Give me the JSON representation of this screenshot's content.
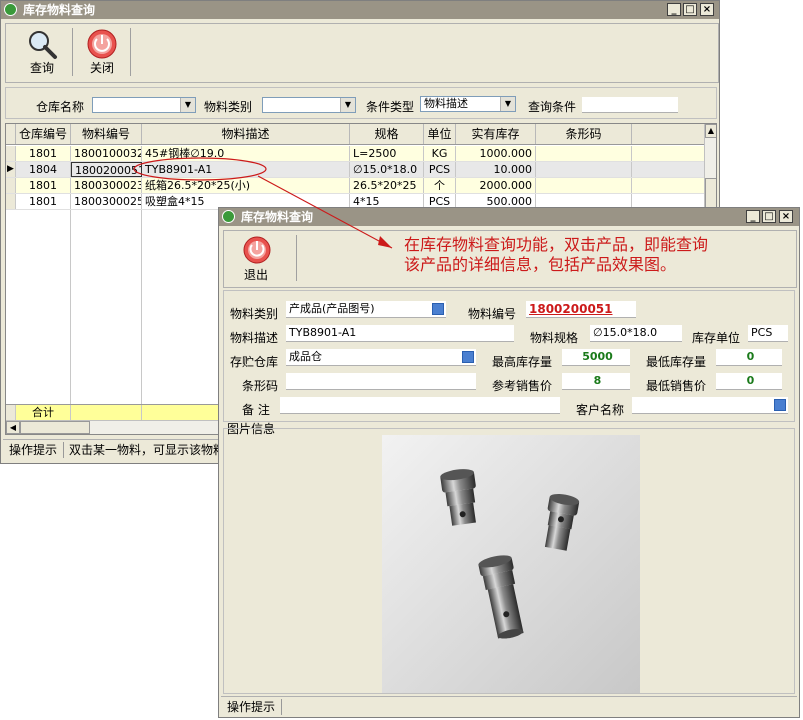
{
  "main_window": {
    "title": "库存物料查询",
    "toolbar": {
      "query_label": "查询",
      "close_label": "关闭"
    },
    "filters": {
      "warehouse_label": "仓库名称",
      "category_label": "物料类别",
      "condition_type_label": "条件类型",
      "condition_type_value": "物料描述",
      "query_condition_label": "查询条件"
    },
    "grid": {
      "columns": [
        "仓库编号",
        "物料编号",
        "物料描述",
        "规格",
        "单位",
        "实有库存",
        "条形码"
      ],
      "rows": [
        [
          "1801",
          "1800100032",
          "45#钢棒∅19.0",
          "L=2500",
          "KG",
          "1000.000",
          ""
        ],
        [
          "1804",
          "1800200051",
          "TYB8901-A1",
          "∅15.0*18.0",
          "PCS",
          "10.000",
          ""
        ],
        [
          "1801",
          "1800300023",
          "纸箱26.5*20*25(小)",
          "26.5*20*25",
          "个",
          "2000.000",
          ""
        ],
        [
          "1801",
          "1800300025",
          "吸塑盒4*15",
          "4*15",
          "PCS",
          "500.000",
          ""
        ]
      ],
      "total_label": "合计"
    },
    "status": {
      "hint_label": "操作提示",
      "hint_text": "双击某一物料，可显示该物料"
    }
  },
  "detail_window": {
    "title": "库存物料查询",
    "exit_label": "退出",
    "annotation": [
      "在库存物料查询功能，双击产品，即能查询",
      "该产品的详细信息，包括产品效果图。"
    ],
    "form": {
      "category_label": "物料类别",
      "category_value": "产成品(产品图号)",
      "code_label": "物料编号",
      "code_value": "1800200051",
      "desc_label": "物料描述",
      "desc_value": "TYB8901-A1",
      "spec_label": "物料规格",
      "spec_value": "∅15.0*18.0",
      "unit_label": "库存单位",
      "unit_value": "PCS",
      "warehouse_label": "存贮仓库",
      "warehouse_value": "成品仓",
      "max_stock_label": "最高库存量",
      "max_stock_value": "5000",
      "min_stock_label": "最低库存量",
      "min_stock_value": "0",
      "barcode_label": "条形码",
      "barcode_value": "",
      "ref_price_label": "参考销售价",
      "ref_price_value": "8",
      "min_price_label": "最低销售价",
      "min_price_value": "0",
      "remark_label": "备 注",
      "remark_value": "",
      "customer_label": "客户名称",
      "customer_value": ""
    },
    "image_section_label": "图片信息",
    "status_label": "操作提示"
  },
  "colors": {
    "accent_red": "#cc1a1a",
    "value_green": "#1a7a1a",
    "total_row": "#ffff99",
    "title_bar": "#9a9486"
  }
}
